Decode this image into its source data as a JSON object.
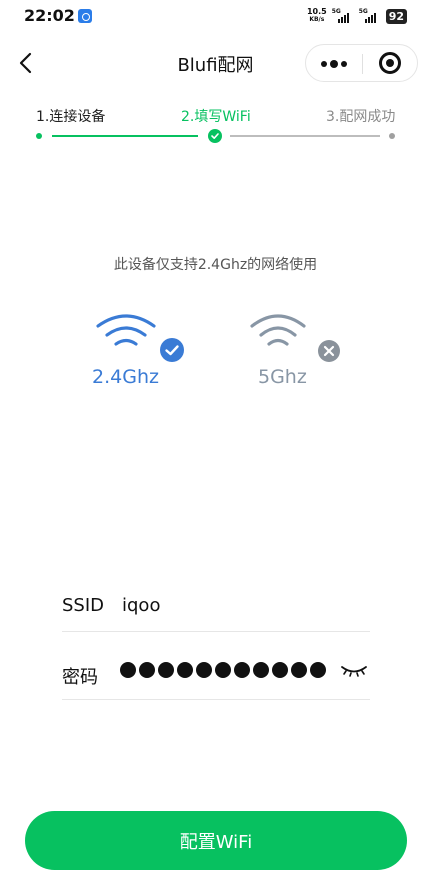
{
  "status_bar": {
    "time": "22:02",
    "net_speed": "10.5",
    "net_speed_unit": "KB/s",
    "sim1_type": "5G",
    "sim2_type": "5G",
    "battery": "92"
  },
  "nav": {
    "title": "Blufi配网"
  },
  "steps": [
    {
      "label": "1.连接设备",
      "state": "done"
    },
    {
      "label": "2.填写WiFi",
      "state": "active"
    },
    {
      "label": "3.配网成功",
      "state": "pending"
    }
  ],
  "notice": "此设备仅支持2.4Ghz的网络使用",
  "bands": [
    {
      "label": "2.4Ghz",
      "supported": true
    },
    {
      "label": "5Ghz",
      "supported": false
    }
  ],
  "form": {
    "ssid_label": "SSID",
    "ssid_value": "iqoo",
    "password_label": "密码",
    "password_masked_count": 11
  },
  "submit_button": "配置WiFi",
  "colors": {
    "primary": "#07c160",
    "supported_band": "#3a7bd5",
    "unsupported_band": "#8896a5"
  }
}
